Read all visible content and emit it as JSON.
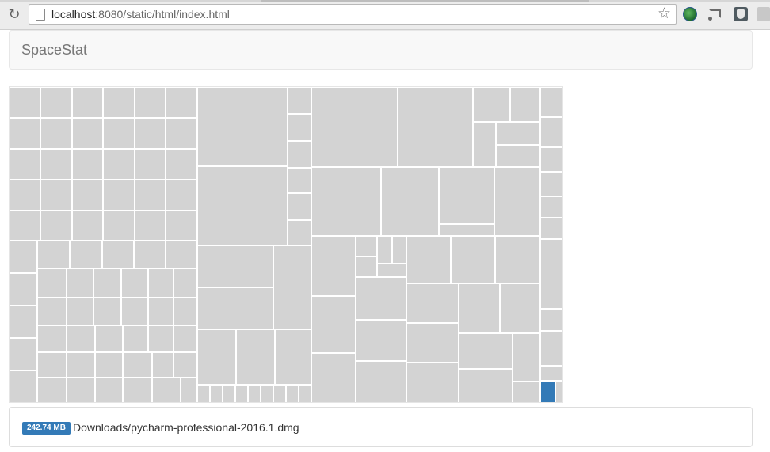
{
  "browser": {
    "url_host": "localhost",
    "url_path": ":8080/static/html/index.html",
    "icons": [
      "reload-icon",
      "page-icon",
      "star-icon",
      "globe-extension-icon",
      "cast-icon",
      "shield-extension-icon",
      "settings-extension-icon"
    ]
  },
  "navbar": {
    "brand": "SpaceStat"
  },
  "treemap": {
    "fill_color": "#d3d3d3",
    "selected_color": "#337ab7",
    "border_color": "#ffffff"
  },
  "selection": {
    "size": "242.74 MB",
    "path": "Downloads/pycharm-professional-2016.1.dmg"
  },
  "colors": {
    "navbar_bg": "#f8f8f8",
    "badge_bg": "#337ab7",
    "brand_text": "#777777"
  }
}
